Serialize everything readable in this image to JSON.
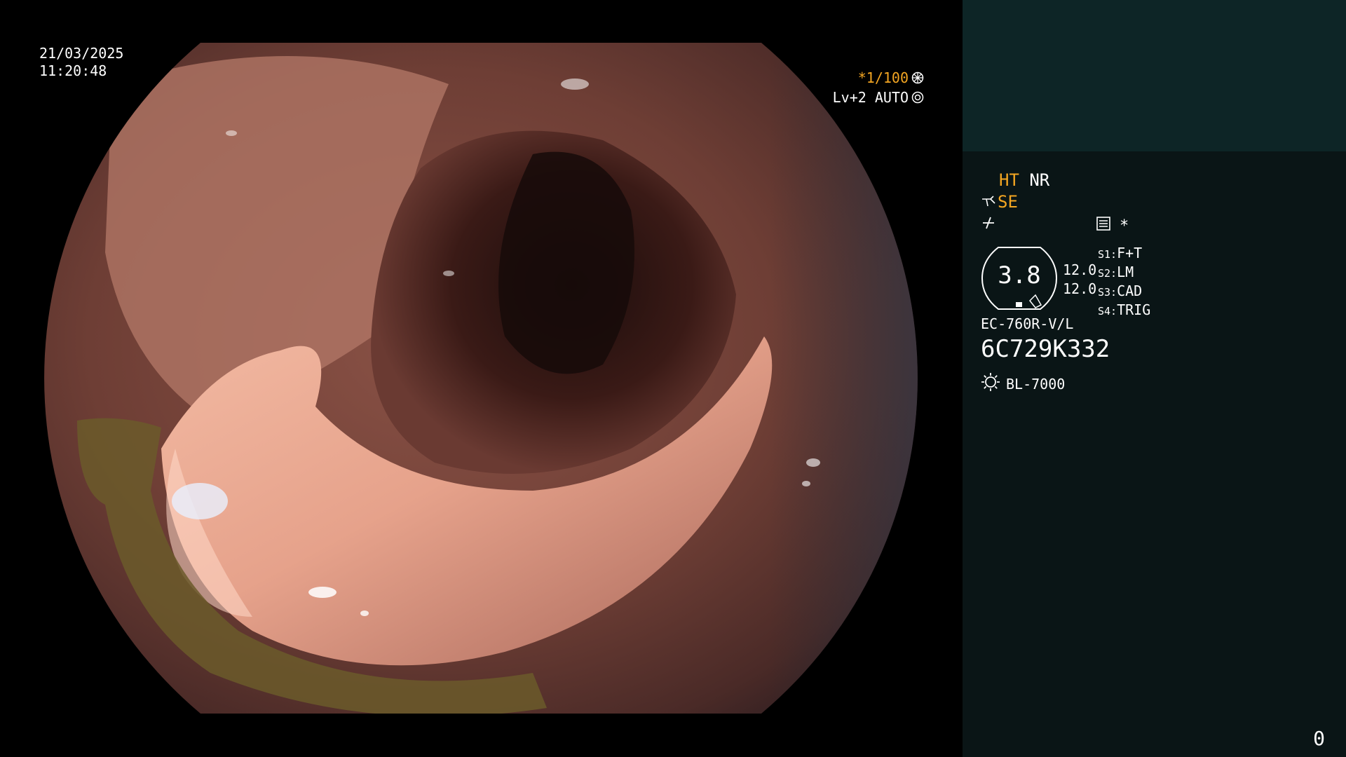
{
  "overlay": {
    "date": "21/03/2025",
    "time": "11:20:48",
    "shutter": "*1/100",
    "level": "Lv+2 AUTO"
  },
  "panel": {
    "ht_label": "HT",
    "nr_label": "NR",
    "se_label": "SE",
    "star_label": "*",
    "dial_value": "3.8",
    "dial_num_1": "12.0",
    "dial_num_2": "12.0",
    "switches": [
      {
        "key": "S1:",
        "value": "F+T"
      },
      {
        "key": "S2:",
        "value": "LM"
      },
      {
        "key": "S3:",
        "value": "CAD"
      },
      {
        "key": "S4:",
        "value": "TRIG"
      }
    ],
    "scope_model": "EC-760R-V/L",
    "scope_serial": "6C729K332",
    "light_source": "BL-7000",
    "counter": "0"
  },
  "colors": {
    "accent_orange": "#f4a622",
    "panel_top": "#0d2526",
    "panel_bg": "#0a1516"
  },
  "icons": [
    "aperture-icon",
    "iris-icon",
    "scope-icon",
    "enhance-icon",
    "memory-icon",
    "light-icon"
  ]
}
